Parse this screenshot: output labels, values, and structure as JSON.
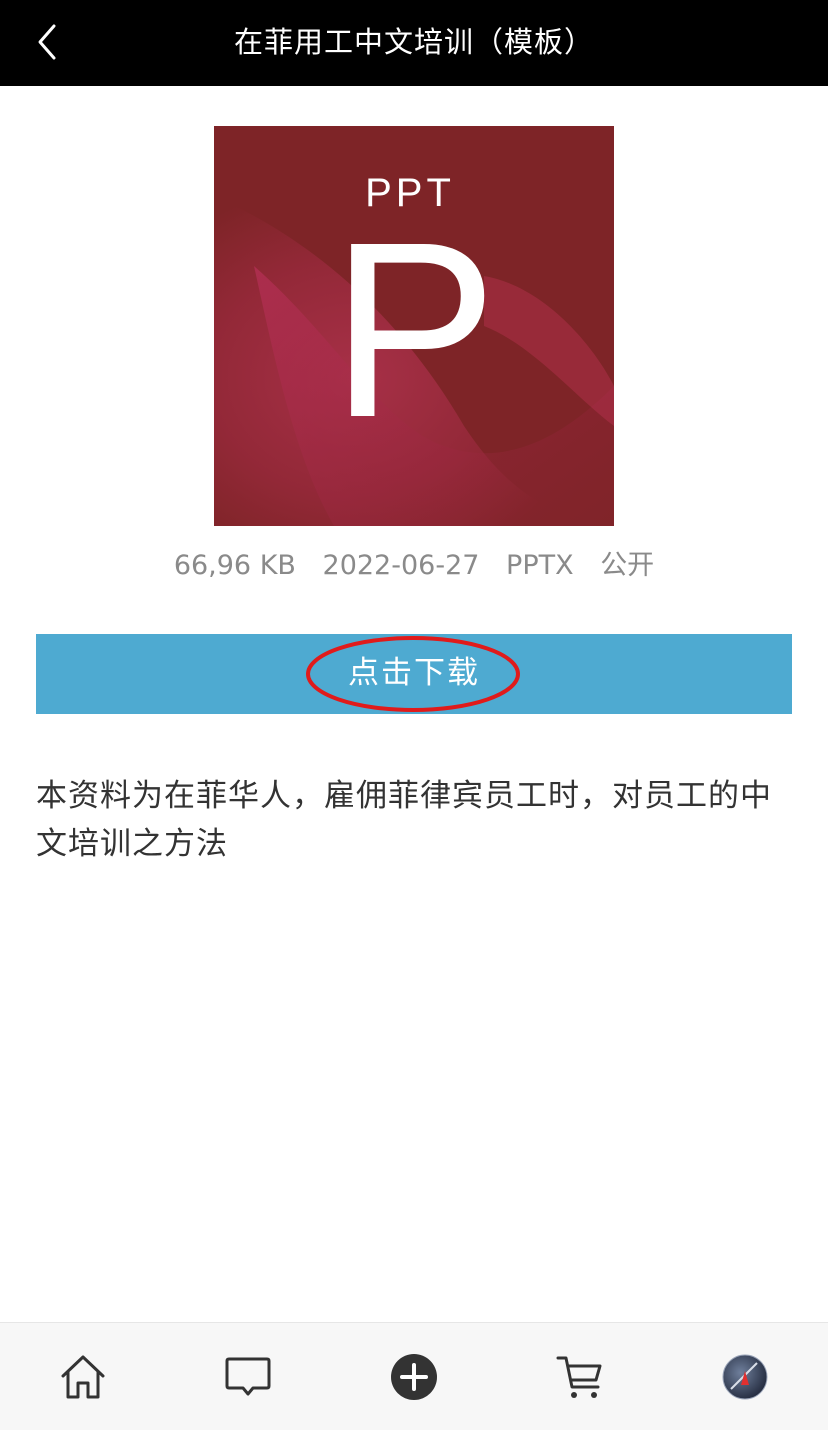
{
  "header": {
    "back_icon": "chevron-left-icon",
    "title": "在菲用工中文培训（模板）"
  },
  "thumbnail": {
    "icon": "powerpoint-file-icon",
    "label_small": "PPT",
    "label_big": "P",
    "colors": {
      "base": "#7e2427",
      "accent": "#c8365c"
    }
  },
  "meta": {
    "size": "66,96 KB",
    "date": "2022-06-27",
    "type": "PPTX",
    "visibility": "公开"
  },
  "download": {
    "label": "点击下载",
    "color": "#4eaad1",
    "annotation_color": "#e01b1b"
  },
  "description": "本资料为在菲华人，雇佣菲律宾员工时，对员工的中文培训之方法",
  "bottom_nav": {
    "items": [
      {
        "icon": "home-icon"
      },
      {
        "icon": "message-icon"
      },
      {
        "icon": "add-circle-icon"
      },
      {
        "icon": "cart-icon"
      },
      {
        "icon": "user-avatar-icon"
      }
    ]
  }
}
